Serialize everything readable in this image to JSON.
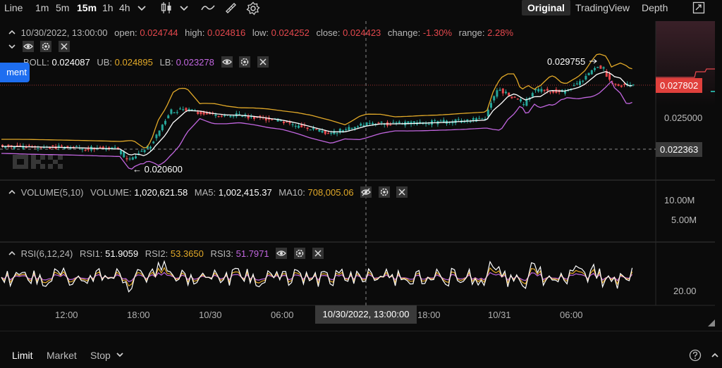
{
  "toolbar": {
    "intervals": [
      "Line",
      "1m",
      "5m",
      "15m",
      "1h",
      "4h"
    ],
    "active_interval": "15m",
    "views": [
      "Original",
      "TradingView",
      "Depth"
    ],
    "active_view": "Original"
  },
  "ohlc": {
    "date": "10/30/2022, 13:00:00",
    "open_label": "open:",
    "open": "0.024744",
    "high_label": "high:",
    "high": "0.024816",
    "low_label": "low:",
    "low": "0.024252",
    "close_label": "close:",
    "close": "0.024423",
    "change_label": "change:",
    "change": "-1.30%",
    "range_label": "range:",
    "range": "2.28%"
  },
  "boll": {
    "name": "BOLL:",
    "mid": "0.024087",
    "ub_label": "UB:",
    "ub": "0.024895",
    "lb_label": "LB:",
    "lb": "0.023278"
  },
  "side_button": "ment",
  "annotations": {
    "high_marker": "0.029755",
    "low_marker": "← 0.020600"
  },
  "price_axis": {
    "current": "0.027802",
    "tick": "0.025000",
    "cross": "0.022363"
  },
  "volume": {
    "name": "VOLUME(5,10)",
    "vol_label": "VOLUME:",
    "vol": "1,020,621.58",
    "ma5_label": "MA5:",
    "ma5": "1,002,415.37",
    "ma10_label": "MA10:",
    "ma10": "708,005.06",
    "ticks": [
      "10.00M",
      "5.00M"
    ]
  },
  "rsi": {
    "name": "RSI(6,12,24)",
    "rsi1_label": "RSI1:",
    "rsi1": "51.9059",
    "rsi2_label": "RSI2:",
    "rsi2": "53.3650",
    "rsi3_label": "RSI3:",
    "rsi3": "51.7971",
    "tick": "20.00"
  },
  "time_axis": {
    "labels": [
      "12:00",
      "18:00",
      "10/30",
      "06:00",
      "18:00",
      "10/31",
      "06:00"
    ],
    "cursor": "10/30/2022, 13:00:00"
  },
  "order_tabs": [
    "Limit",
    "Market",
    "Stop"
  ],
  "colors": {
    "up": "#26a69a",
    "down": "#e5484d",
    "boll_mid": "#ffffff",
    "boll_ub": "#e2a928",
    "boll_lb": "#c266e0",
    "accent": "#1e6ef0"
  }
}
